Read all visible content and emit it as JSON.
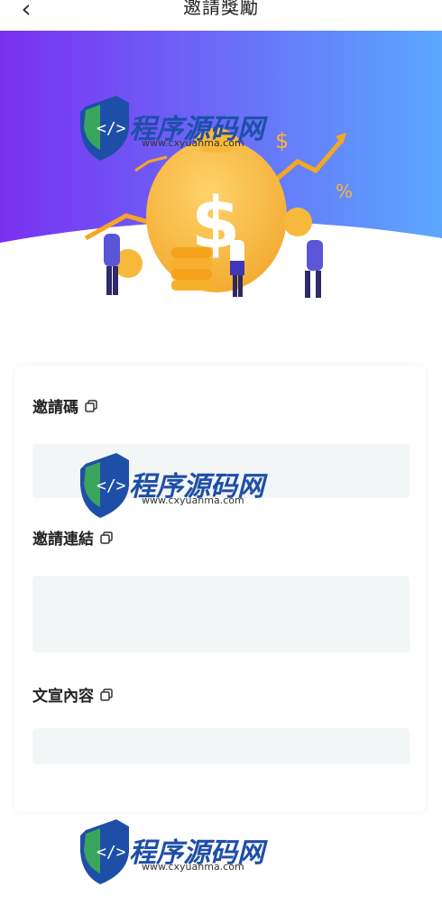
{
  "header": {
    "back_icon": "chevron-left-icon",
    "title": "邀請獎勵"
  },
  "sections": [
    {
      "label": "邀請碼",
      "icon": "copy-icon",
      "value": ""
    },
    {
      "label": "邀請連結",
      "icon": "copy-icon",
      "value": ""
    },
    {
      "label": "文宣內容",
      "icon": "copy-icon",
      "value": ""
    }
  ],
  "watermark": {
    "brand": "程序源码网",
    "url": "www.cxyuanma.com"
  },
  "colors": {
    "banner_left": "#7a2ff0",
    "banner_right": "#5aa8ff",
    "coin": "#f6b93b",
    "field_bg": "#f3f6f7",
    "watermark_blue": "#1e4fa8",
    "watermark_green": "#3aa55c"
  }
}
